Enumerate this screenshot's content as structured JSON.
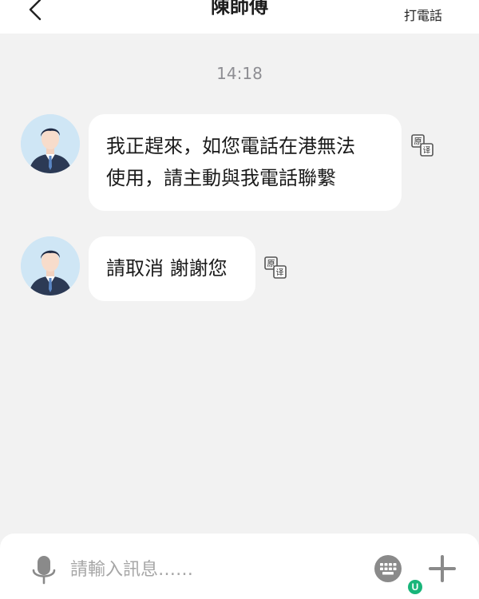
{
  "header": {
    "title": "陳師傅",
    "call_label": "打電話"
  },
  "conversation": {
    "timestamp": "14:18",
    "messages": [
      {
        "text_line1": "我正趕來，如您電話在港無法",
        "text_line2": "使用，請主動與我電話聯繫"
      },
      {
        "text": "請取消 謝謝您"
      }
    ],
    "translate_icon_label_top": "原",
    "translate_icon_label_bottom": "译"
  },
  "input_bar": {
    "placeholder": "請輸入訊息……",
    "badge_letter": "U"
  },
  "colors": {
    "background": "#f2f2f2",
    "bubble": "#ffffff",
    "badge": "#19b57a",
    "icon": "#8a8a8a"
  }
}
